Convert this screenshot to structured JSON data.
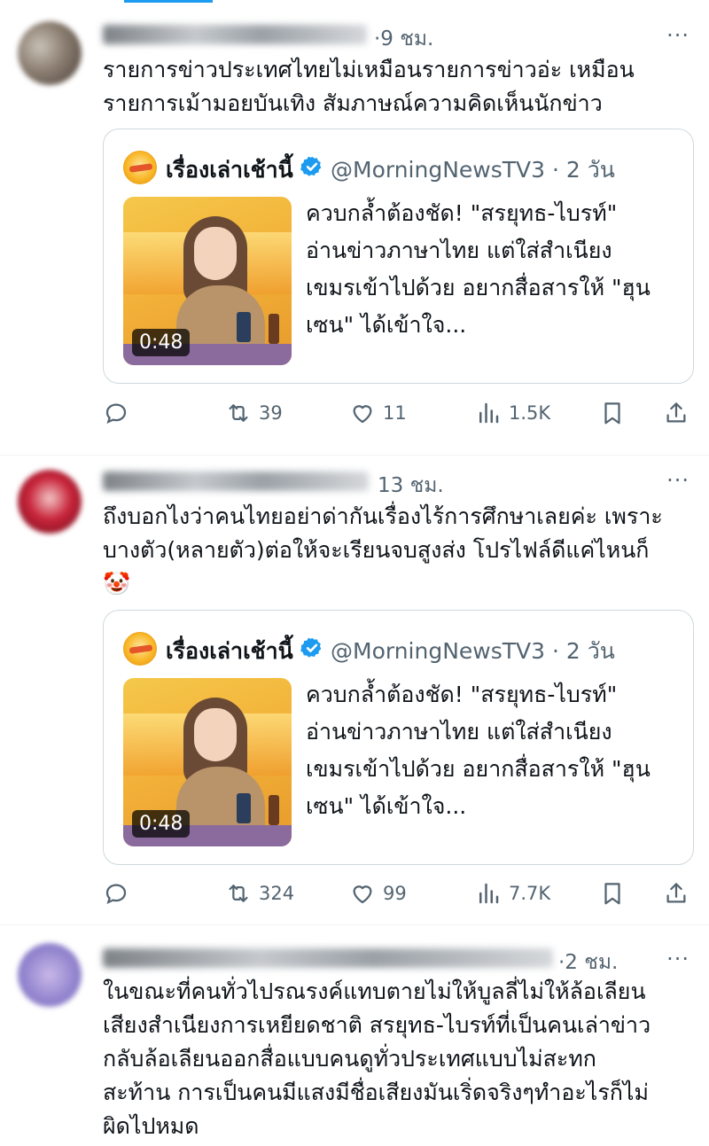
{
  "colors": {
    "accent": "#1d9bf0",
    "muted": "#536471",
    "text": "#0f1419",
    "border": "#cfd9de"
  },
  "tweets": [
    {
      "time": "·9 ชม.",
      "more": "···",
      "text_lines": [
        "รายการข่าวประเทศไทยไม่เหมือนรายการข่าวอ่ะ เหมือน",
        "รายการเม้ามอยบันเทิง สัมภาษณ์ความคิดเห็นนักข่าว"
      ],
      "quote": {
        "name": "เรื่องเล่าเช้านี้",
        "handle": "@MorningNewsTV3 · 2 วัน",
        "duration": "0:48",
        "text_lines": [
          "ควบกล้ำต้องชัด! \"สรยุทธ-ไบรท์\"",
          "อ่านข่าวภาษาไทย แต่ใส่สำเนียง",
          "เขมรเข้าไปด้วย อยากสื่อสารให้ \"ฮุน",
          "เซน\" ได้เข้าใจ..."
        ]
      },
      "actions": {
        "reply": "",
        "retweet": "39",
        "like": "11",
        "views": "1.5K"
      }
    },
    {
      "time": "13 ชม.",
      "more": "···",
      "text_lines": [
        "ถึงบอกไงว่าคนไทยอย่าด่ากันเรื่องไร้การศึกษาเลยค่ะ เพราะ",
        "บางตัว(หลายตัว)ต่อให้จะเรียนจบสูงส่ง โปรไฟล์ดีแค่ไหนก็",
        "🤡"
      ],
      "quote": {
        "name": "เรื่องเล่าเช้านี้",
        "handle": "@MorningNewsTV3 · 2 วัน",
        "duration": "0:48",
        "text_lines": [
          "ควบกล้ำต้องชัด! \"สรยุทธ-ไบรท์\"",
          "อ่านข่าวภาษาไทย แต่ใส่สำเนียง",
          "เขมรเข้าไปด้วย อยากสื่อสารให้ \"ฮุน",
          "เซน\" ได้เข้าใจ..."
        ]
      },
      "actions": {
        "reply": "",
        "retweet": "324",
        "like": "99",
        "views": "7.7K"
      }
    },
    {
      "time": "·2 ชม.",
      "more": "···",
      "text_lines": [
        "ในขณะที่คนทั่วไปรณรงค์แทบตายไม่ให้บูลลี่ไม่ให้ล้อเลียน",
        "เสียงสำเนียงการเหยียดชาติ สรยุทธ-ไบรท์ที่เป็นคนเล่าข่าว",
        "กลับล้อเลียนออกสื่อแบบคนดูทั่วประเทศแบบไม่สะทก",
        "สะท้าน การเป็นคนมีแสงมีชื่อเสียงมันเริ่ดจริงๆทำอะไรก็ไม่",
        "ผิดไปหมด"
      ]
    }
  ]
}
